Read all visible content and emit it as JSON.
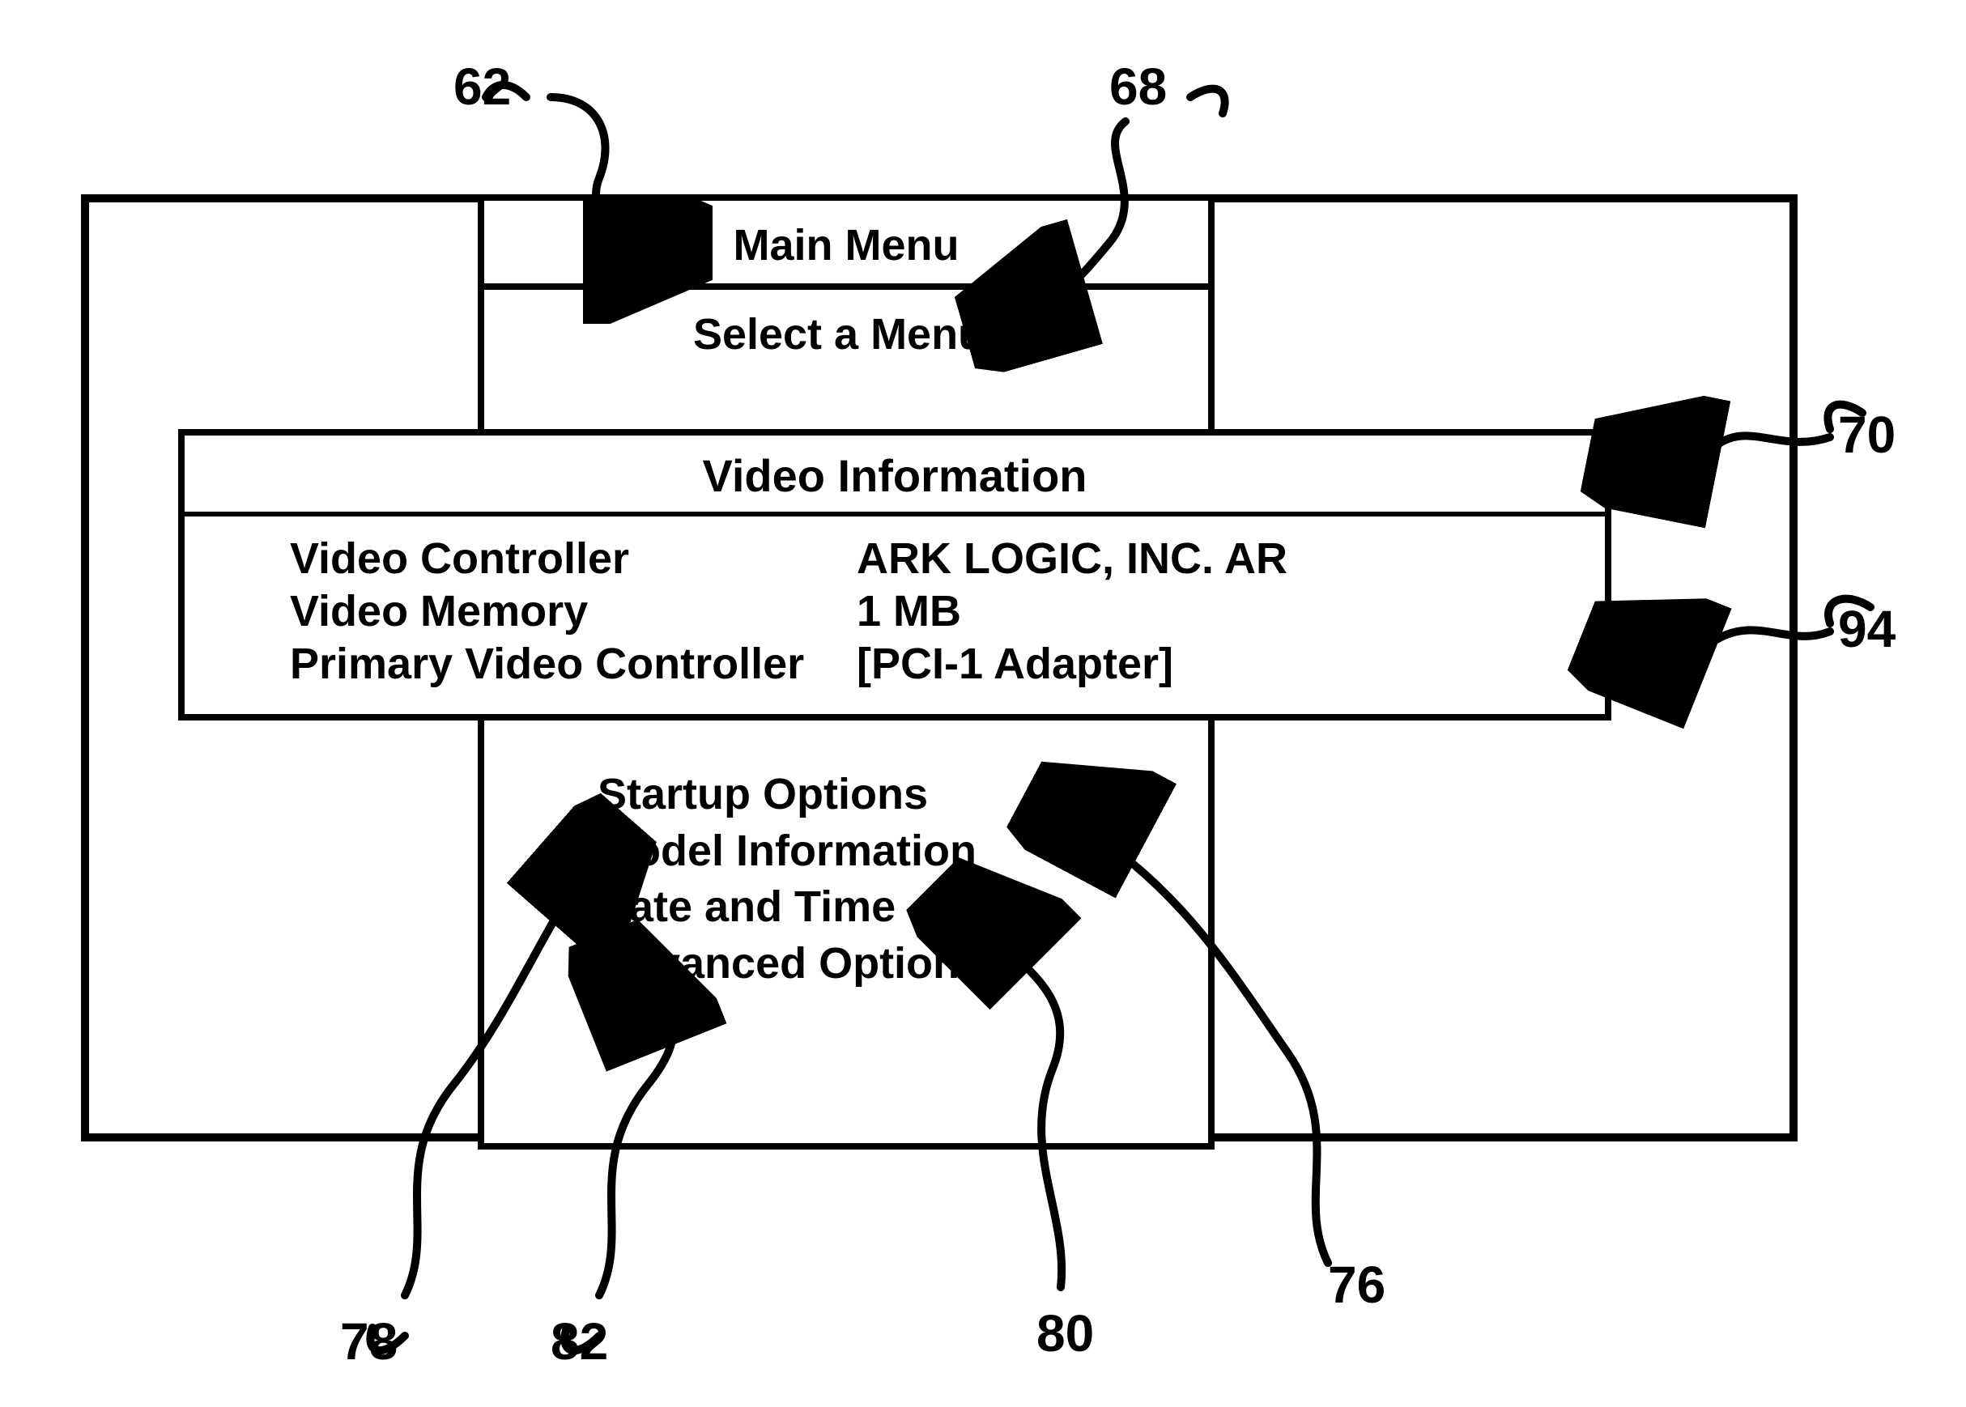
{
  "refs": {
    "r62": "62",
    "r68": "68",
    "r70": "70",
    "r94": "94",
    "r76": "76",
    "r78": "78",
    "r80": "80",
    "r82": "82"
  },
  "main_menu": {
    "title": "Main Menu",
    "select_prompt": "Select a Menu:",
    "options": {
      "startup": "Startup Options",
      "model": "Model Information",
      "datetime": "Date and Time",
      "advanced": "Advanced Options"
    }
  },
  "video_info": {
    "title": "Video Information",
    "rows": {
      "controller_label": "Video Controller",
      "controller_value": "ARK LOGIC, INC. AR",
      "memory_label": "Video Memory",
      "memory_value": "1 MB",
      "primary_label": "Primary Video Controller",
      "primary_value": "[PCI-1 Adapter]"
    }
  }
}
